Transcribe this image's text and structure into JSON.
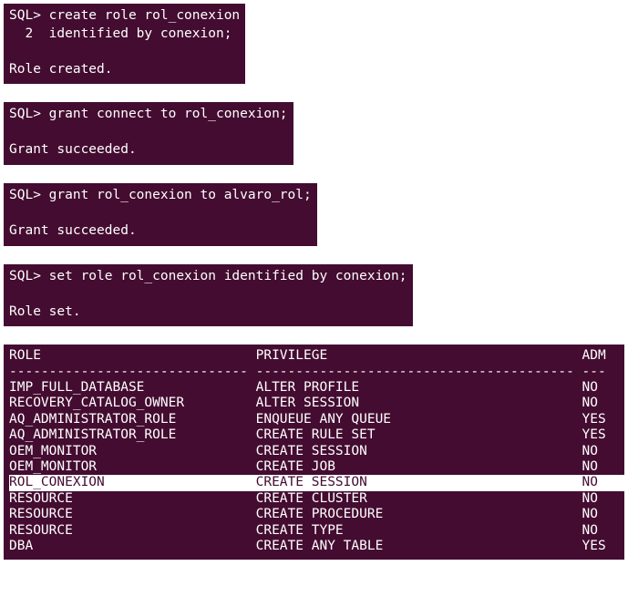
{
  "blocks": {
    "b1": {
      "l1": "SQL> create role rol_conexion",
      "l2": "  2  identified by conexion;",
      "l3": "",
      "l4": "Role created."
    },
    "b2": {
      "l1": "SQL> grant connect to rol_conexion;",
      "l2": "",
      "l3": "Grant succeeded."
    },
    "b3": {
      "l1": "SQL> grant rol_conexion to alvaro_rol;",
      "l2": "",
      "l3": "Grant succeeded."
    },
    "b4": {
      "l1": "SQL> set role rol_conexion identified by conexion;",
      "l2": "",
      "l3": "Role set."
    }
  },
  "table": {
    "hdr_role": "ROLE",
    "hdr_priv": "PRIVILEGE",
    "hdr_adm": "ADM",
    "rule_role": "------------------------------",
    "rule_priv": "----------------------------------------",
    "rule_adm": "---",
    "rows": [
      {
        "role": "IMP_FULL_DATABASE",
        "priv": "ALTER PROFILE",
        "adm": "NO",
        "hl": false
      },
      {
        "role": "RECOVERY_CATALOG_OWNER",
        "priv": "ALTER SESSION",
        "adm": "NO",
        "hl": false
      },
      {
        "role": "AQ_ADMINISTRATOR_ROLE",
        "priv": "ENQUEUE ANY QUEUE",
        "adm": "YES",
        "hl": false
      },
      {
        "role": "AQ_ADMINISTRATOR_ROLE",
        "priv": "CREATE RULE SET",
        "adm": "YES",
        "hl": false
      },
      {
        "role": "OEM_MONITOR",
        "priv": "CREATE SESSION",
        "adm": "NO",
        "hl": false
      },
      {
        "role": "OEM_MONITOR",
        "priv": "CREATE JOB",
        "adm": "NO",
        "hl": false
      },
      {
        "role": "ROL_CONEXION",
        "priv": "CREATE SESSION",
        "adm": "NO",
        "hl": true
      },
      {
        "role": "RESOURCE",
        "priv": "CREATE CLUSTER",
        "adm": "NO",
        "hl": false
      },
      {
        "role": "RESOURCE",
        "priv": "CREATE PROCEDURE",
        "adm": "NO",
        "hl": false
      },
      {
        "role": "RESOURCE",
        "priv": "CREATE TYPE",
        "adm": "NO",
        "hl": false
      },
      {
        "role": "DBA",
        "priv": "CREATE ANY TABLE",
        "adm": "YES",
        "hl": false
      }
    ]
  },
  "colw": {
    "role": 31,
    "priv": 41,
    "adm": 3
  }
}
